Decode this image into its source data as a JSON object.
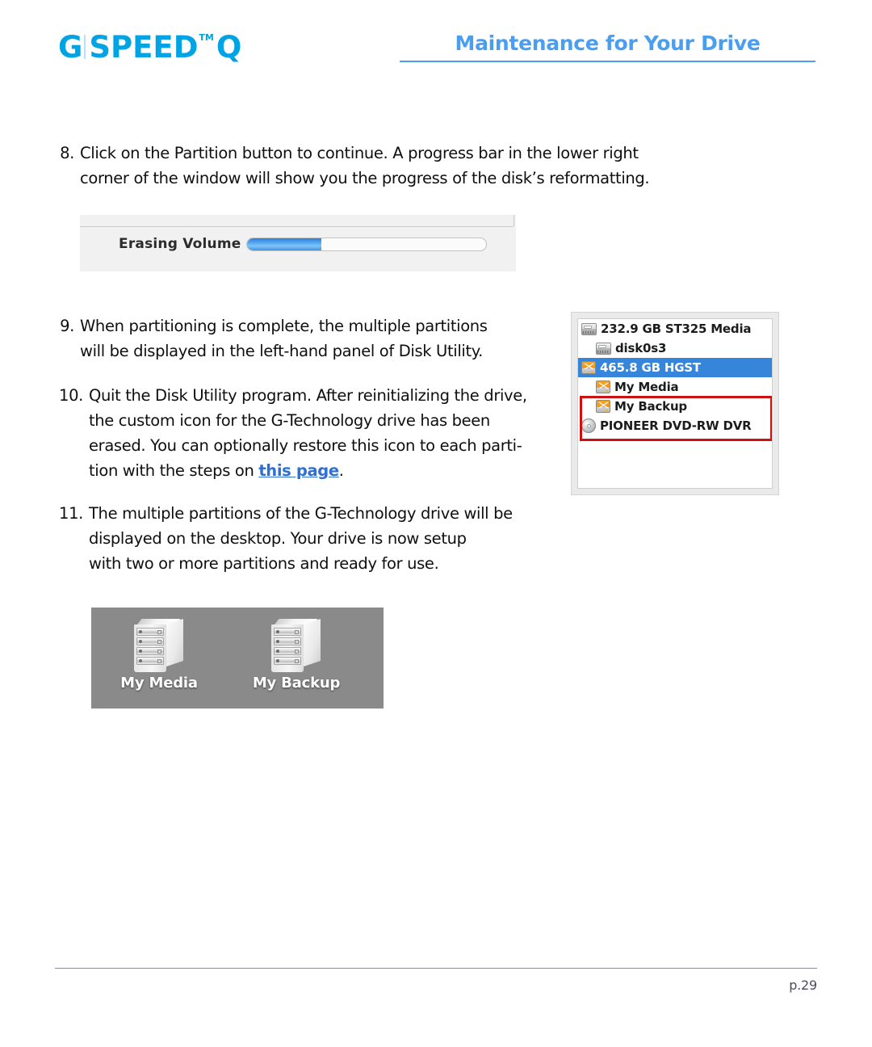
{
  "header": {
    "logo": {
      "g": "G",
      "speed": "SPEED",
      "tm": "TM",
      "q": "Q",
      "brand_color": "#00a3e4"
    },
    "title": "Maintenance for Your Drive",
    "title_color": "#4a9ef0"
  },
  "steps": [
    {
      "number": "8.",
      "lines": [
        "Click on the Partition button to continue. A progress bar in the lower right",
        "corner of the window will show you the progress of the disk’s reformatting."
      ]
    },
    {
      "number": "9.",
      "lines": [
        "When partitioning is complete, the multiple partitions",
        "will be displayed in the left-hand panel of Disk Utility."
      ]
    },
    {
      "number": "10.",
      "lines": [
        "Quit the Disk Utility program. After reinitializing the drive,",
        "the custom icon for the G-Technology drive has been",
        "erased. You can optionally restore this icon to each parti-"
      ],
      "last_line_prefix": "tion with the steps on ",
      "link_label": "this page",
      "last_line_suffix": "."
    },
    {
      "number": "11.",
      "lines": [
        "The multiple partitions of the G-Technology drive will be",
        "displayed on the desktop. Your drive is now setup",
        "with two or more partitions and ready for use."
      ]
    }
  ],
  "erasing_panel": {
    "label": "Erasing Volume",
    "progress_percent": 31,
    "fill_color": "#56a9ef"
  },
  "disk_utility": {
    "selection_color": "#3585da",
    "highlight_box_color": "#cc1111",
    "rows": [
      {
        "label": "232.9 GB ST325 Media",
        "icon": "hard-drive-icon",
        "indent": false,
        "selected": false
      },
      {
        "label": "disk0s3",
        "icon": "hard-drive-icon",
        "indent": true,
        "selected": false
      },
      {
        "label": "465.8 GB HGST",
        "icon": "volume-icon",
        "indent": false,
        "selected": true
      },
      {
        "label": "My Media",
        "icon": "volume-icon",
        "indent": true,
        "selected": false
      },
      {
        "label": "My Backup",
        "icon": "volume-icon",
        "indent": true,
        "selected": false
      },
      {
        "label": "PIONEER DVD-RW DVR",
        "icon": "optical-disc-icon",
        "indent": false,
        "selected": false
      }
    ]
  },
  "desktop_icons": [
    {
      "label": "My Media",
      "icon": "drive-enclosure-icon"
    },
    {
      "label": "My Backup",
      "icon": "drive-enclosure-icon"
    }
  ],
  "footer": {
    "page_label": "p.29"
  }
}
